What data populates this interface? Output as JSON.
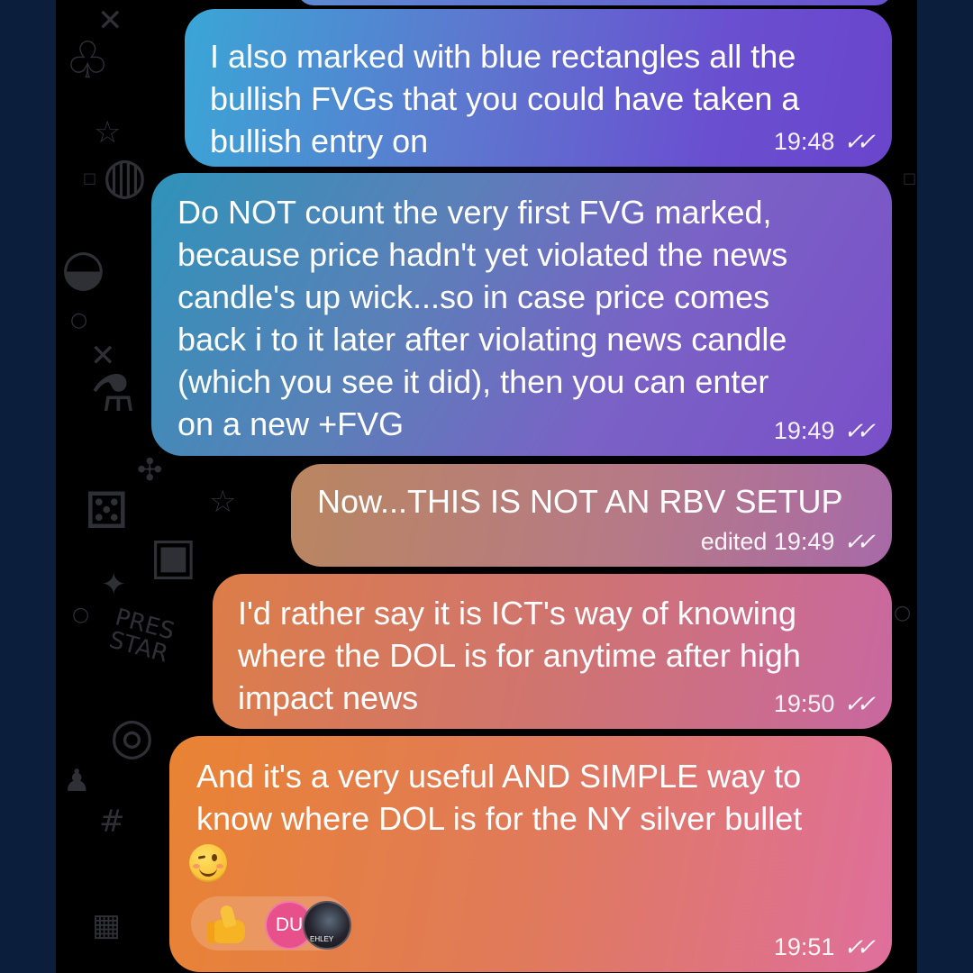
{
  "messages": [
    {
      "text": "I also marked with blue rectangles all the\nbullish FVGs that you could have taken a\nbullish entry on",
      "time": "19:48"
    },
    {
      "text": "Do NOT count the very first FVG marked,\nbecause price hadn't yet violated the news\ncandle's up wick...so in case price comes\nback i to it later after violating news candle\n(which you see it did), then you can enter\non a new +FVG",
      "time": "19:49"
    },
    {
      "text": "Now...THIS IS NOT AN RBV SETUP",
      "time": "edited 19:49"
    },
    {
      "text": "I'd rather say it is ICT's way of knowing\nwhere the DOL is for anytime after high\nimpact news",
      "time": "19:50"
    },
    {
      "text": "And  it's a very useful AND SIMPLE way to\nknow where DOL is for the NY silver bullet",
      "time": "19:51",
      "emoji": "winking-face"
    }
  ],
  "reactions": {
    "emoji": "thumbs-up",
    "avatars": [
      {
        "initials": "DU",
        "color": "#e8508c"
      },
      {
        "label": "EHLEY"
      }
    ]
  },
  "read_status_icon": "double-check-icon",
  "colors": {
    "background": "#0b1f3d",
    "chat_background": "#000000"
  }
}
